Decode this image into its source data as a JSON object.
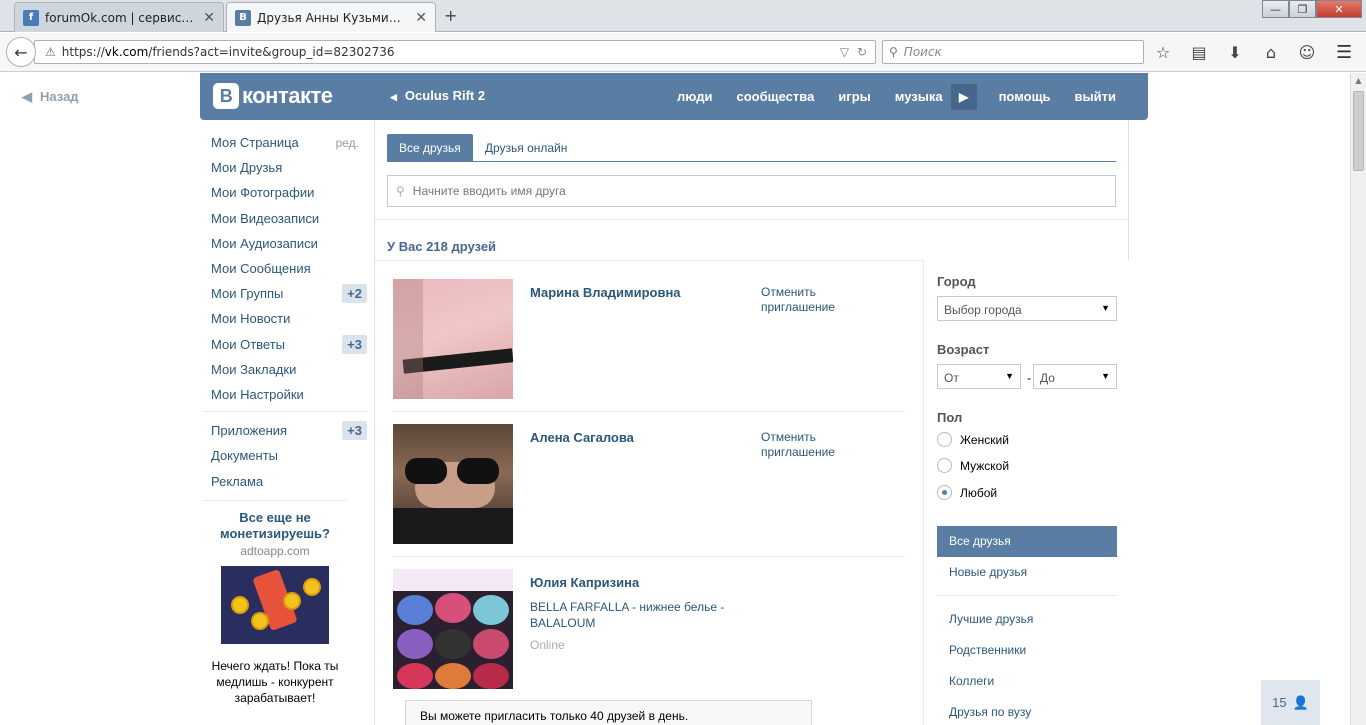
{
  "browser": {
    "tabs": [
      {
        "title": "forumOk.com | сервис ре...",
        "favicon": "forumok-icon"
      },
      {
        "title": "Друзья Анны Кузьминой |...",
        "favicon": "vk-icon"
      }
    ],
    "url_prefix": "https://",
    "url_domain": "vk.com",
    "url_path": "/friends?act=invite&group_id=82302736",
    "search_placeholder": "Поиск"
  },
  "page": {
    "back_label": "Назад"
  },
  "header": {
    "logo_text": "контакте",
    "logo_letter": "В",
    "group_name": "Oculus Rift 2",
    "nav": [
      "люди",
      "сообщества",
      "игры",
      "музыка",
      "помощь",
      "выйти"
    ]
  },
  "leftmenu": {
    "edit_label": "ред.",
    "items": [
      {
        "label": "Моя Страница",
        "badge": ""
      },
      {
        "label": "Мои Друзья",
        "badge": ""
      },
      {
        "label": "Мои Фотографии",
        "badge": ""
      },
      {
        "label": "Мои Видеозаписи",
        "badge": ""
      },
      {
        "label": "Мои Аудиозаписи",
        "badge": ""
      },
      {
        "label": "Мои Сообщения",
        "badge": ""
      },
      {
        "label": "Мои Группы",
        "badge": "+2"
      },
      {
        "label": "Мои Новости",
        "badge": ""
      },
      {
        "label": "Мои Ответы",
        "badge": "+3"
      },
      {
        "label": "Мои Закладки",
        "badge": ""
      },
      {
        "label": "Мои Настройки",
        "badge": ""
      }
    ],
    "extra": [
      {
        "label": "Приложения",
        "badge": "+3"
      },
      {
        "label": "Документы",
        "badge": ""
      },
      {
        "label": "Реклама",
        "badge": ""
      }
    ]
  },
  "ad": {
    "title": "Все еще не монетизируешь?",
    "domain": "adtoapp.com",
    "text": "Нечего ждать! Пока ты медлишь - конкурент зарабатывает!"
  },
  "main": {
    "tabs": [
      "Все друзья",
      "Друзья онлайн"
    ],
    "search_placeholder": "Начните вводить имя друга",
    "summary": "У Вас 218 друзей",
    "friends": [
      {
        "name": "Марина Владимировна",
        "sub": "",
        "status": "",
        "action": "Отменить приглашение"
      },
      {
        "name": "Алена Сагалова",
        "sub": "",
        "status": "",
        "action": "Отменить приглашение"
      },
      {
        "name": "Юлия Капризина",
        "sub": "BELLA FARFALLA - нижнее белье - BALALOUM",
        "status": "Online",
        "action": ""
      }
    ],
    "notice": "Вы можете пригласить только 40 друзей в день."
  },
  "filters": {
    "city_label": "Город",
    "city_value": "Выбор города",
    "age_label": "Возраст",
    "age_from": "От",
    "age_to": "До",
    "sex_label": "Пол",
    "sex_options": [
      "Женский",
      "Мужской",
      "Любой"
    ],
    "sex_selected": "Любой",
    "links": [
      "Все друзья",
      "Новые друзья",
      "Лучшие друзья",
      "Родственники",
      "Коллеги",
      "Друзья по вузу"
    ]
  },
  "online_counter": "15",
  "colors": {
    "vk_blue": "#597da3",
    "link": "#2b587a"
  }
}
